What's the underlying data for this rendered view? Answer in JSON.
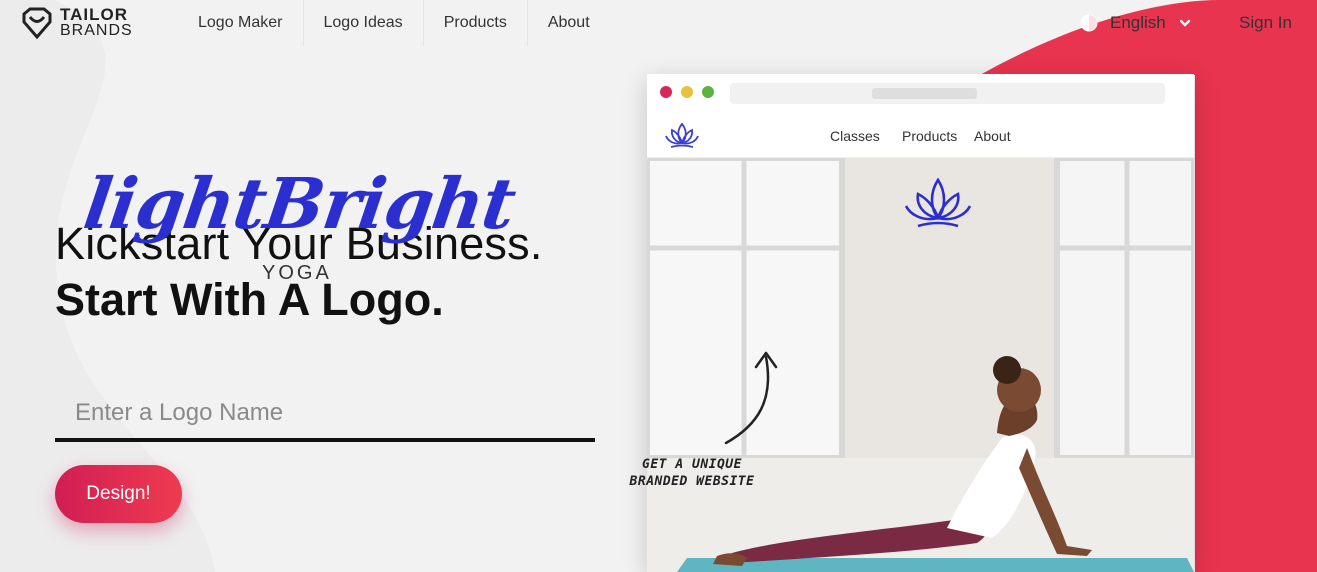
{
  "brand": {
    "line1": "TAILOR",
    "line2": "BRANDS"
  },
  "nav": {
    "items": [
      {
        "label": "Logo Maker"
      },
      {
        "label": "Logo Ideas"
      },
      {
        "label": "Products"
      },
      {
        "label": "About"
      }
    ],
    "language": "English",
    "signin": "Sign In"
  },
  "hero": {
    "line1": "Kickstart Your Business.",
    "line2": "Start With A Logo.",
    "input_placeholder": "Enter a Logo Name",
    "button_label": "Design!"
  },
  "mockup": {
    "nav": [
      "Classes",
      "Products",
      "About"
    ],
    "brand_script": "lightBright",
    "brand_sub": "YOGA",
    "cta_line1": "GET A UNIQUE",
    "cta_line2": "BRANDED WEBSITE"
  },
  "colors": {
    "accent_start": "#d01e55",
    "accent_end": "#ef3b4f",
    "brand_blue": "#2b2fd0"
  }
}
